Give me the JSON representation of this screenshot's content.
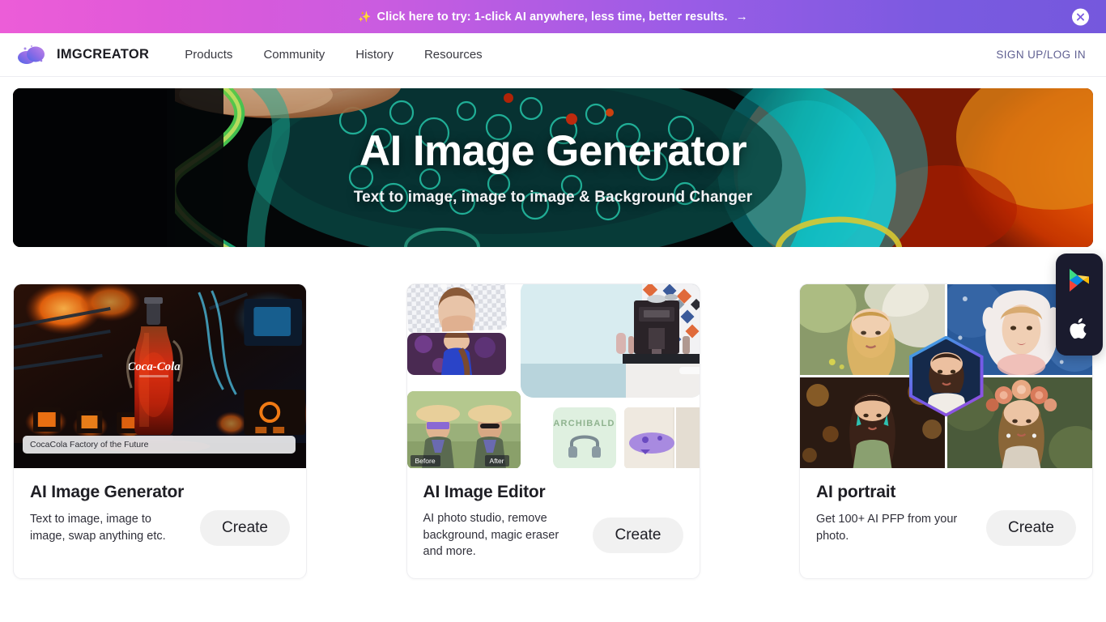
{
  "promo": {
    "sparkle_icon": "sparkles-icon",
    "text": "Click here to try: 1-click AI anywhere, less time, better results.",
    "arrow": "→",
    "close_icon": "close-icon",
    "gradient_start": "#ec5dd8",
    "gradient_end": "#7a5ae0"
  },
  "navbar": {
    "logo_icon": "imgcreator-blob-logo-icon",
    "brand": "IMGCREATOR",
    "links": [
      {
        "label": "Products"
      },
      {
        "label": "Community"
      },
      {
        "label": "History"
      },
      {
        "label": "Resources"
      }
    ],
    "auth_label": "SIGN UP/LOG IN",
    "auth_color": "#5f5f91"
  },
  "hero": {
    "title": "AI Image Generator",
    "subtitle": "Text to image, image to image & Background Changer"
  },
  "cards": [
    {
      "name": "ai-image-generator",
      "title": "AI Image Generator",
      "description": "Text to image, image to image, swap anything etc.",
      "button": "Create",
      "media_caption": "CocaCola Factory of the Future"
    },
    {
      "name": "ai-image-editor",
      "title": "AI Image Editor",
      "description": "AI photo studio, remove background, magic eraser and more.",
      "button": "Create",
      "before_label": "Before",
      "after_label": "After",
      "product_badge": "ARCHIBALD"
    },
    {
      "name": "ai-portrait",
      "title": "AI portrait",
      "description": "Get 100+ AI PFP from your photo.",
      "button": "Create"
    }
  ],
  "app_float": {
    "google_play_icon": "google-play-icon",
    "apple_icon": "apple-icon"
  }
}
